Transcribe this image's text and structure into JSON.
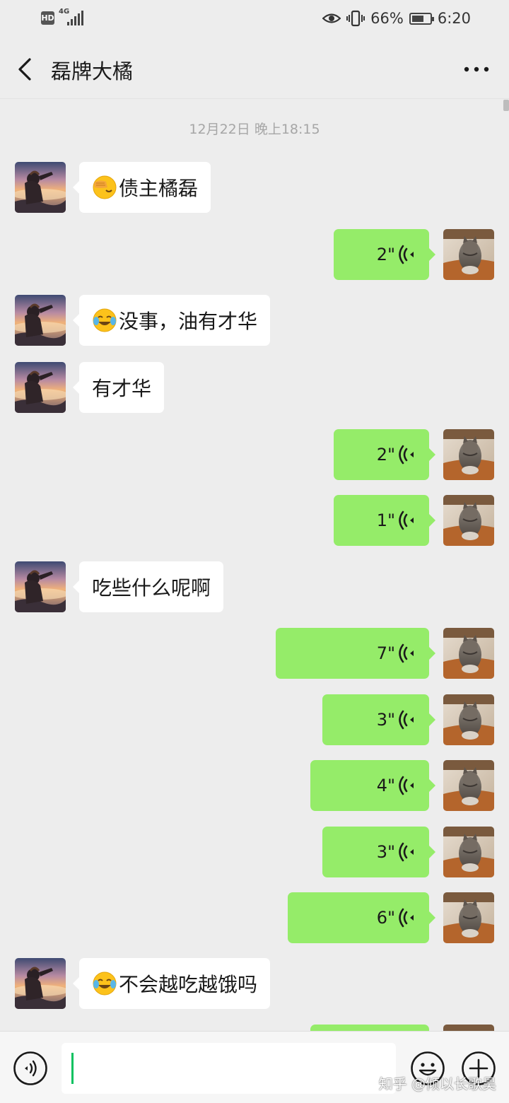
{
  "status_bar": {
    "hd": "HD",
    "network": "4G",
    "battery": "66%",
    "battery_level": 0.66,
    "time": "6:20"
  },
  "header": {
    "title": "磊牌大橘",
    "back_icon": "chevron-left-icon",
    "more_icon": "more-horizontal-icon"
  },
  "messages": {
    "timestamp": "12月22日 晚上18:15",
    "list": [
      {
        "from": "them",
        "kind": "text",
        "emoji": "facepalm-emoji",
        "text": "债主橘磊"
      },
      {
        "from": "me",
        "kind": "voice",
        "duration": "2\""
      },
      {
        "from": "them",
        "kind": "text",
        "emoji": "tears-of-joy-emoji",
        "text": "没事，油有才华"
      },
      {
        "from": "them",
        "kind": "text",
        "text": "有才华"
      },
      {
        "from": "me",
        "kind": "voice",
        "duration": "2\""
      },
      {
        "from": "me",
        "kind": "voice",
        "duration": "1\""
      },
      {
        "from": "them",
        "kind": "text",
        "text": "吃些什么呢啊"
      },
      {
        "from": "me",
        "kind": "voice",
        "duration": "7\""
      },
      {
        "from": "me",
        "kind": "voice",
        "duration": "3\""
      },
      {
        "from": "me",
        "kind": "voice",
        "duration": "4\""
      },
      {
        "from": "me",
        "kind": "voice",
        "duration": "3\""
      },
      {
        "from": "me",
        "kind": "voice",
        "duration": "6\""
      },
      {
        "from": "them",
        "kind": "text",
        "emoji": "tears-of-joy-emoji",
        "text": "不会越吃越饿吗"
      }
    ]
  },
  "input_bar": {
    "voice_icon": "voice-mode-icon",
    "emoji_icon": "smiley-icon",
    "plus_icon": "plus-circle-icon",
    "watermark": "知乎 @倾以长歌昊"
  },
  "colors": {
    "background": "#ededed",
    "outgoing_bubble": "#95ec69",
    "incoming_bubble": "#ffffff",
    "caret": "#07c160",
    "timestamp_text": "#a6a6a6"
  }
}
